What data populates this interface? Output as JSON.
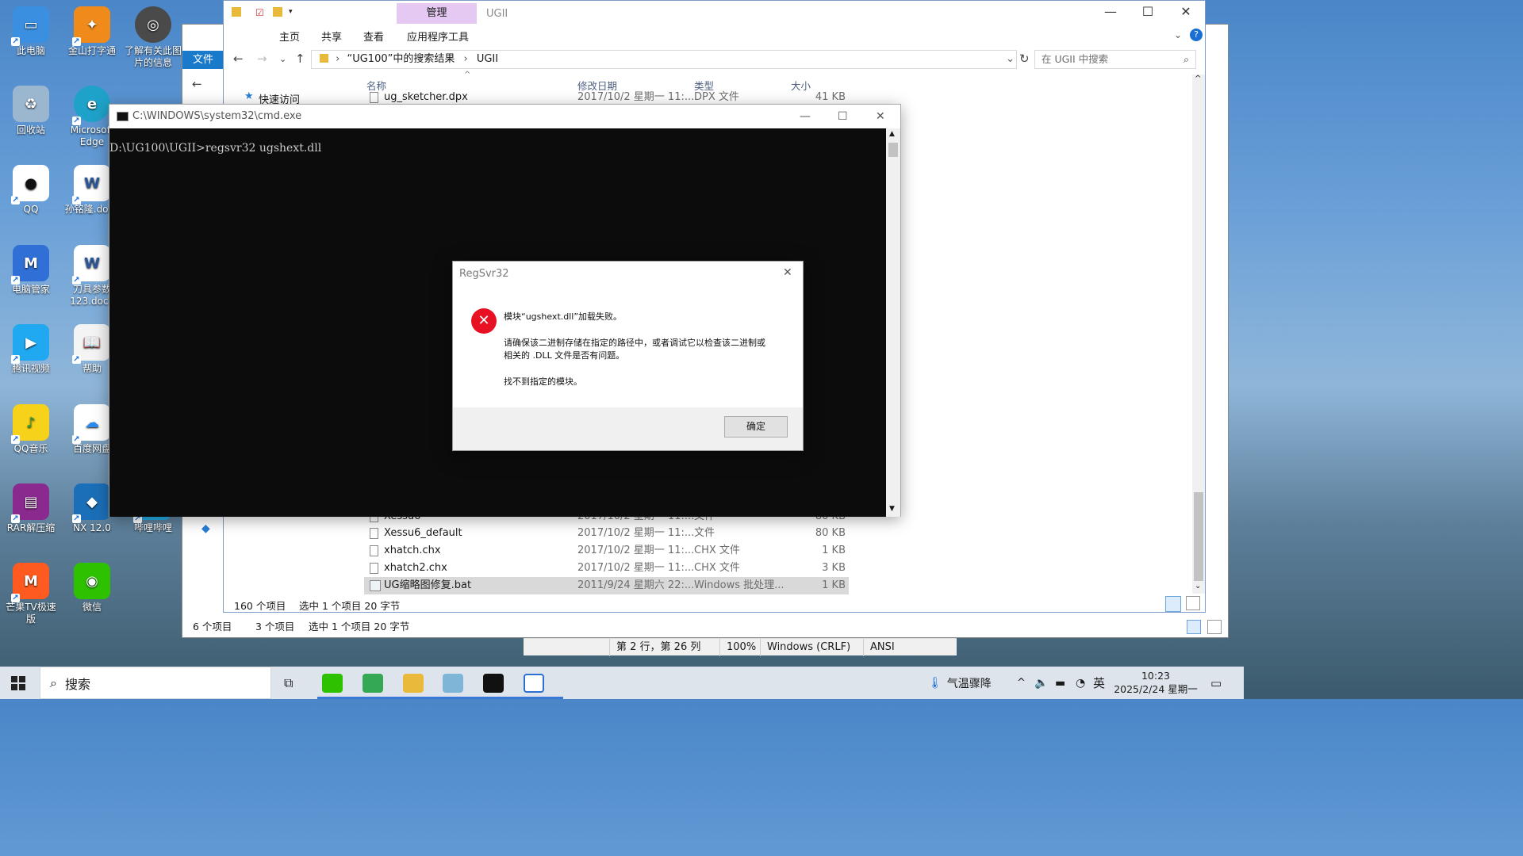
{
  "desktop_icons": [
    {
      "label": "此电脑",
      "color": "#3b8fe0"
    },
    {
      "label": "回收站",
      "color": "#9ab7cf"
    },
    {
      "label": "QQ",
      "color": "#ffffff"
    },
    {
      "label": "电脑管家",
      "color": "#2f6fd6"
    },
    {
      "label": "腾讯视频",
      "color": "#20a9f0"
    },
    {
      "label": "QQ音乐",
      "color": "#f7d21a"
    },
    {
      "label": "RAR解压缩",
      "color": "#8a2a8f"
    },
    {
      "label": "芒果TV极速版",
      "color": "#ff5a1f"
    },
    {
      "label": "金山打字通",
      "color": "#f08a1a"
    },
    {
      "label": "Microsoft Edge",
      "color": "#1fa2c9"
    },
    {
      "label": "孙铭隆.docx",
      "color": "#ffffff"
    },
    {
      "label": "刀具参数123.docx",
      "color": "#ffffff"
    },
    {
      "label": "帮助",
      "color": "#f4f4f4"
    },
    {
      "label": "百度网盘",
      "color": "#ffffff"
    },
    {
      "label": "NX 12.0",
      "color": "#1b6fb8"
    },
    {
      "label": "微信",
      "color": "#2dc100"
    },
    {
      "label": "了解有关此图片的信息",
      "color": "#4a4a4a"
    },
    {
      "label": "哔哩哔哩",
      "color": "#23ade5"
    }
  ],
  "back_window": {
    "file_tab": "文件",
    "status_left": "6 个项目",
    "status_count": "3 个项目",
    "status_sel": "选中 1 个项目  20 字节"
  },
  "notepad_status": {
    "position": "第 2 行，第 26 列",
    "zoom": "100%",
    "eol": "Windows (CRLF)",
    "encoding": "ANSI"
  },
  "explorer": {
    "title": "UGII",
    "context_tab": "管理",
    "tabs": [
      "主页",
      "共享",
      "查看",
      "应用程序工具"
    ],
    "breadcrumb": [
      "“UG100”中的搜索结果",
      "UGII"
    ],
    "search_placeholder": "在 UGII 中搜索",
    "quick_access": "快速访问",
    "columns": [
      "名称",
      "修改日期",
      "类型",
      "大小"
    ],
    "files": [
      {
        "name": "ug_sketcher.dpx",
        "date": "2017/10/2 星期一 11:...",
        "type": "DPX 文件",
        "size": "41 KB"
      },
      {
        "name": "Xessu6",
        "date": "2017/10/2 星期一 11:...",
        "type": "文件",
        "size": "80 KB"
      },
      {
        "name": "Xessu6_default",
        "date": "2017/10/2 星期一 11:...",
        "type": "文件",
        "size": "80 KB"
      },
      {
        "name": "xhatch.chx",
        "date": "2017/10/2 星期一 11:...",
        "type": "CHX 文件",
        "size": "1 KB"
      },
      {
        "name": "xhatch2.chx",
        "date": "2017/10/2 星期一 11:...",
        "type": "CHX 文件",
        "size": "3 KB"
      },
      {
        "name": "UG缩略图修复.bat",
        "date": "2011/9/24 星期六 22:...",
        "type": "Windows 批处理...",
        "size": "1 KB"
      }
    ],
    "status_total": "160 个项目",
    "status_sel": "选中 1 个项目  20 字节"
  },
  "cmd": {
    "title": "C:\\WINDOWS\\system32\\cmd.exe",
    "line": "D:\\UG100\\UGII>regsvr32 ugshext.dll"
  },
  "dialog": {
    "title": "RegSvr32",
    "line1": "模块“ugshext.dll”加载失败。",
    "line2": "请确保该二进制存储在指定的路径中，或者调试它以检查该二进制或",
    "line3": "相关的 .DLL 文件是否有问题。",
    "line4": "找不到指定的模块。",
    "ok": "确定"
  },
  "taskbar": {
    "search": "搜索",
    "weather": "气温骤降",
    "ime": "英",
    "time": "10:23",
    "date": "2025/2/24 星期一"
  }
}
